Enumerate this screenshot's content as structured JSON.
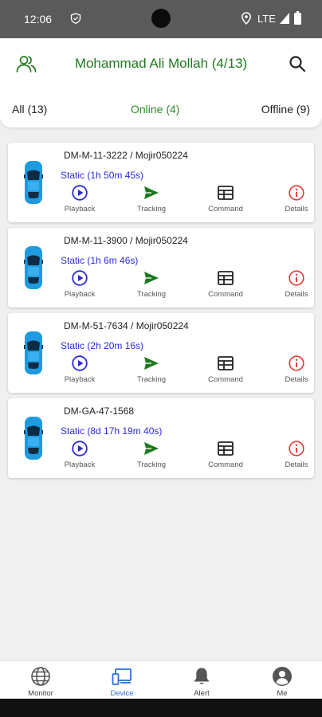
{
  "status_bar": {
    "time": "12:06",
    "network": "LTE"
  },
  "header": {
    "title": "Mohammad Ali Mollah (4/13)",
    "users_icon": "users-icon",
    "search_icon": "search-icon"
  },
  "filters": {
    "all": "All (13)",
    "online": "Online (4)",
    "offline": "Offline (9)"
  },
  "devices": [
    {
      "name": "DM-M-11-3222 / Mojir050224",
      "status": "Static (1h 50m 45s)"
    },
    {
      "name": "DM-M-11-3900 / Mojir050224",
      "status": "Static (1h 6m 46s)"
    },
    {
      "name": "DM-M-51-7634 / Mojir050224",
      "status": "Static (2h 20m 16s)"
    },
    {
      "name": "DM-GA-47-1568",
      "status": "Static (8d 17h 19m 40s)"
    }
  ],
  "actions": {
    "playback": "Playback",
    "tracking": "Tracking",
    "command": "Command",
    "details": "Details"
  },
  "nav": {
    "monitor": "Monitor",
    "device": "Device",
    "alert": "Alert",
    "me": "Me",
    "active": "device"
  },
  "colors": {
    "title_green": "#1f7a1f",
    "status_blue": "#2b2bd8",
    "tracking_green": "#1f7a1f",
    "details_red": "#e53935",
    "nav_active_blue": "#2f6fd9",
    "car_blue": "#1e9be0"
  }
}
